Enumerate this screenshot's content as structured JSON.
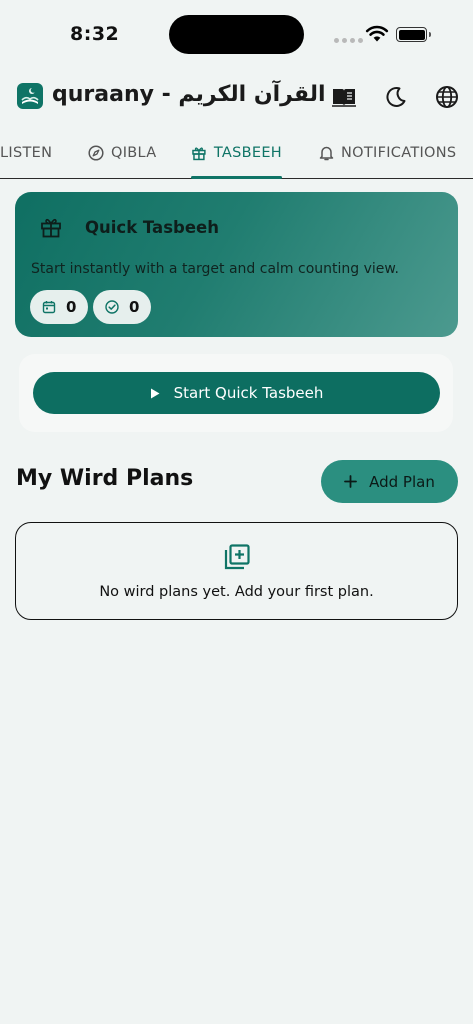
{
  "status_bar": {
    "time": "8:32"
  },
  "header": {
    "title": "quraany - القرآن الكريم",
    "icons": [
      "book-icon",
      "moon-icon",
      "globe-icon"
    ]
  },
  "tabs": [
    {
      "label": "LISTEN",
      "icon": "headphones-icon",
      "active": false
    },
    {
      "label": "QIBLA",
      "icon": "compass-icon",
      "active": false
    },
    {
      "label": "TASBEEH",
      "icon": "gift-icon",
      "active": true
    },
    {
      "label": "NOTIFICATIONS",
      "icon": "bell-icon",
      "active": false
    }
  ],
  "quick_tasbeeh": {
    "title": "Quick Tasbeeh",
    "description": "Start instantly with a target and calm counting view.",
    "today_count": "0",
    "completed_count": "0",
    "start_label": "Start Quick Tasbeeh"
  },
  "wird_plans": {
    "title": "My Wird Plans",
    "add_label": "Add Plan",
    "empty_text": "No wird plans yet. Add your first plan."
  },
  "colors": {
    "accent": "#0f7466",
    "background": "#f0f4f3",
    "add_button": "#2b8f80"
  }
}
